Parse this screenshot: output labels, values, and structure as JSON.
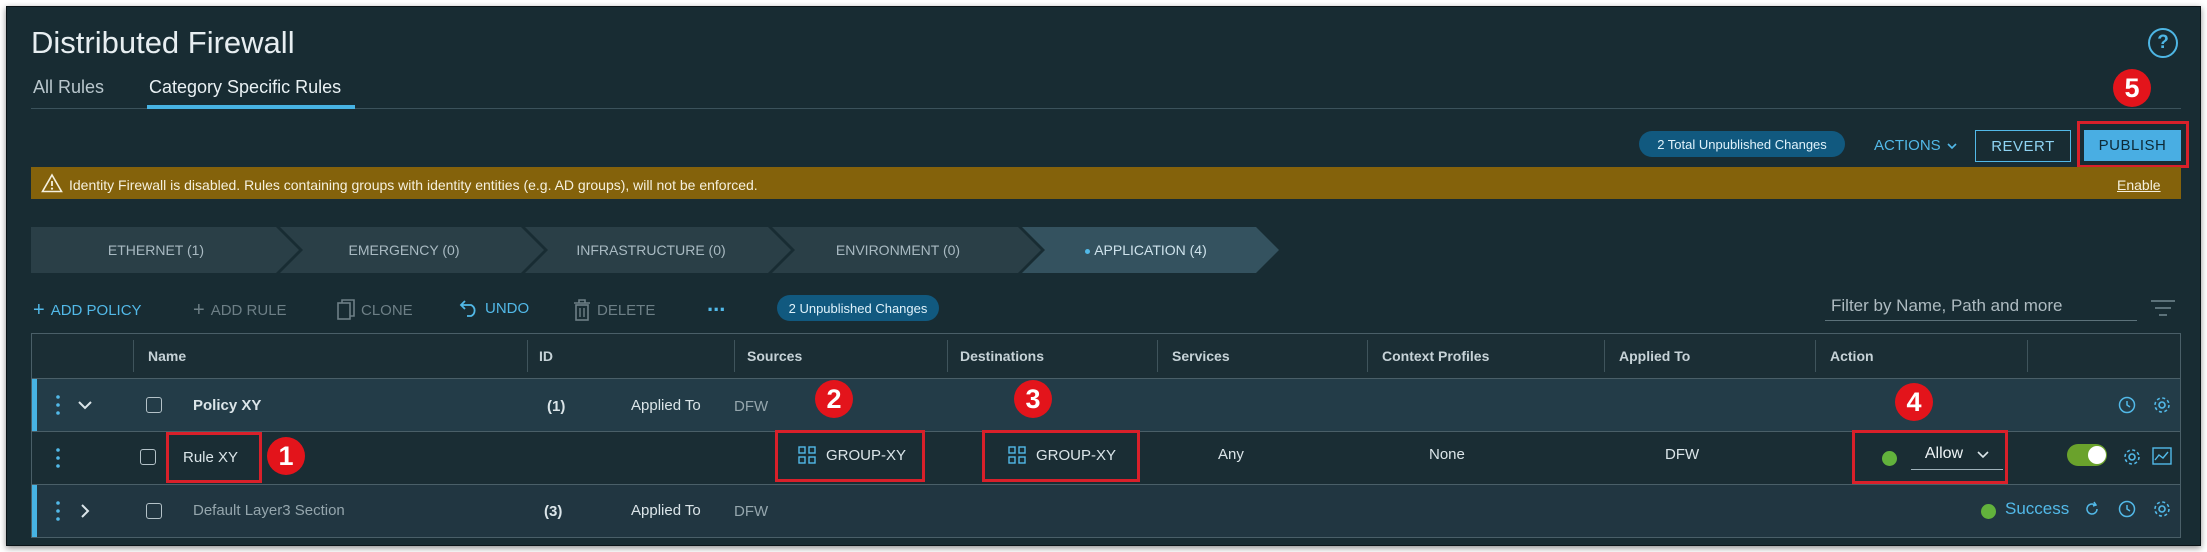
{
  "header": {
    "title": "Distributed Firewall",
    "help_icon": "?",
    "tabs": [
      {
        "label": "All Rules"
      },
      {
        "label": "Category Specific Rules"
      }
    ]
  },
  "toolbar_top": {
    "unpublished_total": "2 Total Unpublished Changes",
    "actions_label": "ACTIONS",
    "revert_label": "REVERT",
    "publish_label": "PUBLISH"
  },
  "banner": {
    "text": "Identity Firewall is disabled. Rules containing groups with identity entities (e.g. AD groups), will not be enforced.",
    "link": "Enable",
    "color": "#84620b"
  },
  "categories": [
    {
      "label": "ETHERNET (1)"
    },
    {
      "label": "EMERGENCY (0)"
    },
    {
      "label": "INFRASTRUCTURE (0)"
    },
    {
      "label": "ENVIRONMENT (0)"
    },
    {
      "label": "APPLICATION (4)"
    }
  ],
  "tools": {
    "add_policy": "ADD POLICY",
    "add_rule": "ADD RULE",
    "clone": "CLONE",
    "undo": "UNDO",
    "delete": "DELETE",
    "more": "...",
    "unpublished": "2 Unpublished Changes",
    "filter_placeholder": "Filter by Name, Path and more"
  },
  "table": {
    "columns": [
      "Name",
      "ID",
      "Sources",
      "Destinations",
      "Services",
      "Context Profiles",
      "Applied To",
      "Action"
    ],
    "policy_row": {
      "name": "Policy XY",
      "id": "(1)",
      "applied_to_label": "Applied To",
      "applied_to": "DFW"
    },
    "rule_row": {
      "name": "Rule XY",
      "source": "GROUP-XY",
      "destination": "GROUP-XY",
      "services": "Any",
      "context_profiles": "None",
      "applied_to": "DFW",
      "action": "Allow"
    },
    "section_row": {
      "name": "Default Layer3 Section",
      "id": "(3)",
      "applied_to_label": "Applied To",
      "applied_to": "DFW",
      "status": "Success"
    }
  },
  "callouts": [
    "1",
    "2",
    "3",
    "4",
    "5"
  ],
  "colors": {
    "accent": "#47b3e3",
    "callout": "#e3141b",
    "toggle_on": "#6aa22c"
  }
}
